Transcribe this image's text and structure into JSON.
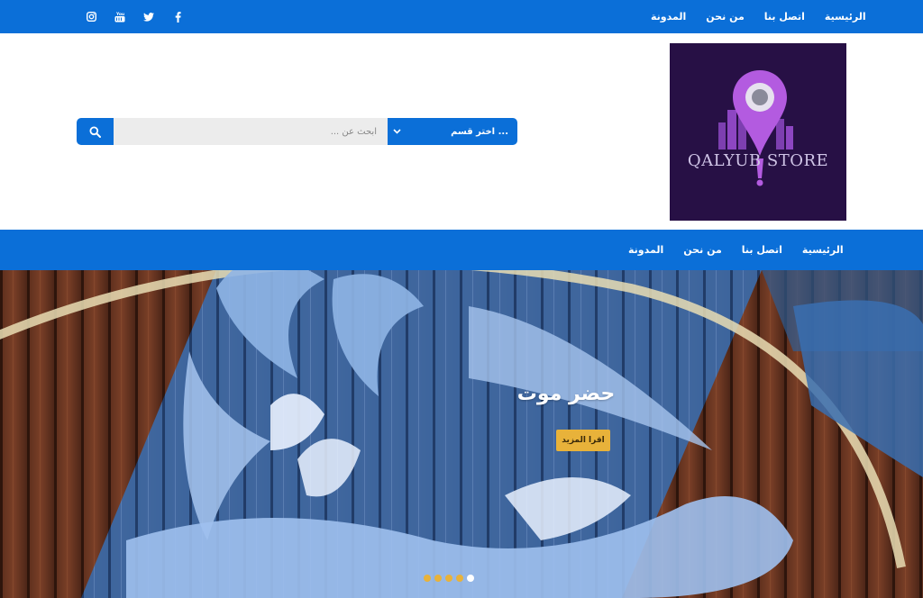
{
  "topbar": {
    "menu": [
      {
        "label": "الرئيسية"
      },
      {
        "label": "اتصل بنا"
      },
      {
        "label": "من نحن"
      },
      {
        "label": "المدونة"
      }
    ],
    "social_icons": [
      "facebook-icon",
      "twitter-icon",
      "youtube-icon",
      "instagram-icon"
    ]
  },
  "header": {
    "logo_text": "QALYUB STORE",
    "search": {
      "placeholder": "ابحث عن ...",
      "category_label": "اختر قسم ..."
    }
  },
  "main_nav": {
    "items": [
      {
        "label": "الرئيسية"
      },
      {
        "label": "اتصل بنا"
      },
      {
        "label": "من نحن"
      },
      {
        "label": "المدونة"
      }
    ]
  },
  "hero": {
    "title": "حضر موت",
    "button_label": "اقرا المزيد",
    "slides_count": 5,
    "active_slide": 5
  },
  "colors": {
    "primary": "#0b6fd8",
    "accent": "#e8b23a",
    "logo_bg": "#271045",
    "logo_accent": "#b35be0"
  }
}
